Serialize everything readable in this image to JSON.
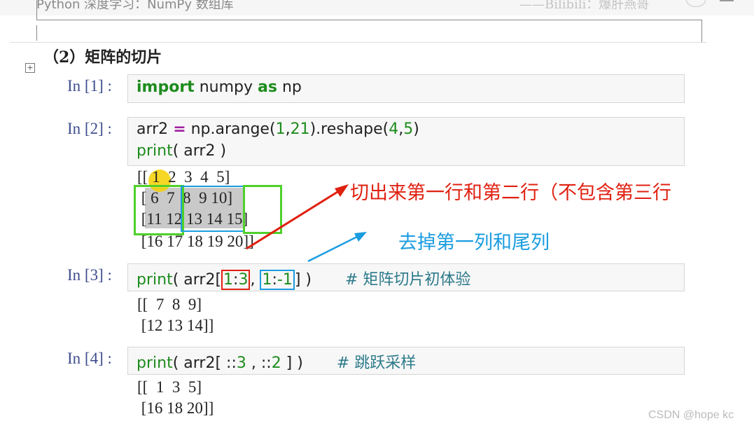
{
  "header": {
    "title": "Python 深度学习：NumPy 数组库",
    "right_watermark": "——Bilibili：爆肝燕哥"
  },
  "section": {
    "title": "（2）矩阵的切片"
  },
  "cells": [
    {
      "prompt": "In [1] :",
      "code": {
        "t1": "import",
        "t2": " numpy ",
        "t3": "as",
        "t4": " np"
      }
    },
    {
      "prompt": "In [2] :",
      "code": {
        "l1a": "arr2 ",
        "l1b": "=",
        "l1c": " np.arange(",
        "l1d": "1",
        "l1e": ",",
        "l1f": "21",
        "l1g": ").reshape(",
        "l1h": "4",
        "l1i": ",",
        "l1j": "5",
        "l1k": ")",
        "l2a": "print",
        "l2b": "( arr2 )"
      },
      "output": [
        "[[ 1  2  3  4  5]",
        " [ 6  7  8  9 10]",
        " [11 12 13 14 15]",
        " [16 17 18 19 20]]"
      ]
    },
    {
      "prompt": "In [3] :",
      "code": {
        "a": "print",
        "b": "( arr2[",
        "c": "1",
        "d": ":",
        "e": "3",
        "f": ", ",
        "g": "1",
        "h": ":",
        "i": "-1",
        "j": "] )",
        "comment": "#  矩阵切片初体验"
      },
      "output": [
        "[[  7  8  9]",
        " [12 13 14]]"
      ]
    },
    {
      "prompt": "In [4] :",
      "code": {
        "a": "print",
        "b": "( arr2[ ::",
        "c": "3",
        "d": " , ::",
        "e": "2",
        "f": " ] )",
        "comment": "#  跳跃采样"
      },
      "output": [
        "[[  1  3  5]",
        " [16 18 20]]"
      ]
    }
  ],
  "annotations": {
    "red_text": "切出来第一行和第二行（不包含第三行",
    "blue_text": "去掉第一列和尾列",
    "red_color": "#e02010",
    "blue_color": "#1a9ce0",
    "green_color": "#4fd02a",
    "highlight_yellow": "#f5d000"
  },
  "footer": {
    "watermark": "CSDN @hope kc"
  }
}
